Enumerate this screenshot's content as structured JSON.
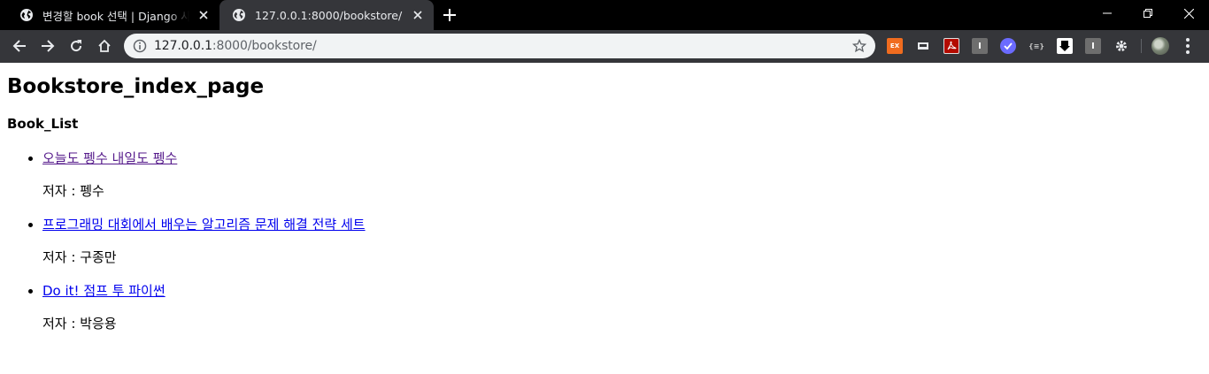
{
  "browser": {
    "tabs": [
      {
        "title": "변경할 book 선택 | Django 사이트 관리",
        "active": false
      },
      {
        "title": "127.0.0.1:8000/bookstore/",
        "active": true
      }
    ],
    "address": {
      "host": "127.0.0.1",
      "path": ":8000/bookstore/"
    },
    "extensions": [
      {
        "name": "ex-extension-icon",
        "label": "EX",
        "color": "#f06c1f"
      },
      {
        "name": "screen-extension-icon",
        "label": "",
        "color": "#5f6368"
      },
      {
        "name": "acrobat-extension-icon",
        "label": "",
        "color": "#b30b00"
      },
      {
        "name": "i-extension-icon",
        "label": "I",
        "color": "#6e6e6e"
      },
      {
        "name": "check-extension-icon",
        "label": "",
        "color": "#6b6bff"
      },
      {
        "name": "json-extension-icon",
        "label": "{≡}",
        "color": "#35363a"
      },
      {
        "name": "download-extension-icon",
        "label": "",
        "color": "#ffffff"
      },
      {
        "name": "i-extension-icon-2",
        "label": "I",
        "color": "#6e6e6e"
      },
      {
        "name": "gear-extension-icon",
        "label": "",
        "color": "#35363a"
      }
    ]
  },
  "page": {
    "heading": "Bookstore_index_page",
    "subheading": "Book_List",
    "books": [
      {
        "title": "오늘도 펭수 내일도 펭수",
        "author_line": "저자 : 펭수",
        "visited": true
      },
      {
        "title": "프로그래밍 대회에서 배우는 알고리즘 문제 해결 전략 세트",
        "author_line": "저자 : 구종만",
        "visited": false
      },
      {
        "title": "Do it! 점프 투 파이썬",
        "author_line": "저자 : 박응용",
        "visited": false
      }
    ]
  },
  "colors": {
    "link": "#0000ee",
    "visited_link": "#551a8b",
    "tabstrip": "#000000",
    "toolbar": "#35363a"
  }
}
